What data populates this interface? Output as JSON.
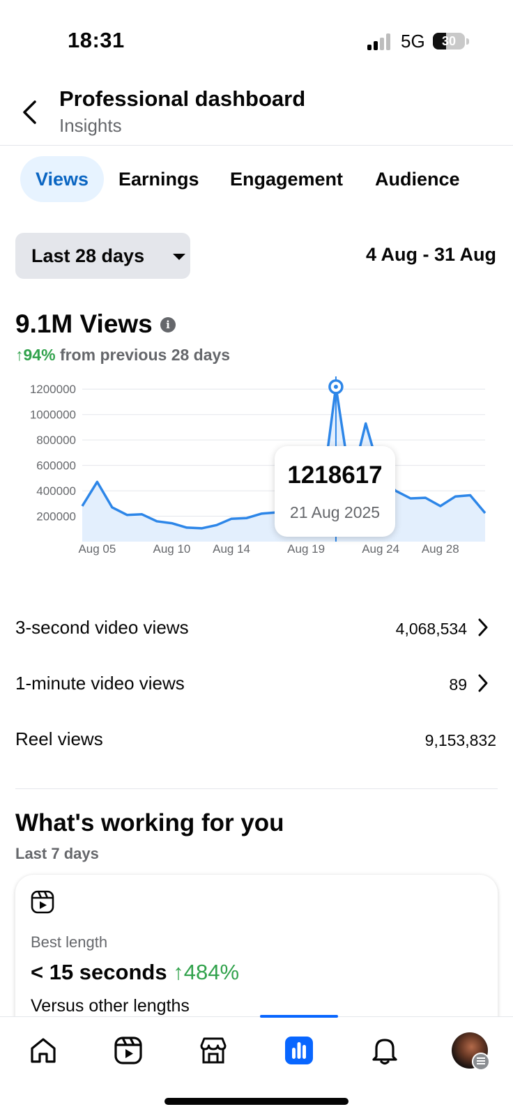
{
  "status_bar": {
    "time": "18:31",
    "network": "5G",
    "battery": "30"
  },
  "header": {
    "title": "Professional dashboard",
    "subtitle": "Insights"
  },
  "tabs": [
    {
      "label": "Views",
      "active": true
    },
    {
      "label": "Earnings",
      "active": false
    },
    {
      "label": "Engagement",
      "active": false
    },
    {
      "label": "Audience",
      "active": false
    }
  ],
  "filter": {
    "period_label": "Last 28 days",
    "date_range": "4 Aug - 31 Aug"
  },
  "summary": {
    "total": "9.1M Views",
    "delta_pct": "↑94%",
    "delta_text": "from previous 28 days"
  },
  "chart_data": {
    "type": "area",
    "x_ticks": [
      "Aug 05",
      "Aug 10",
      "Aug 14",
      "Aug 19",
      "Aug 24",
      "Aug 28"
    ],
    "y_ticks": [
      "1200000",
      "1000000",
      "800000",
      "600000",
      "400000",
      "200000"
    ],
    "ylim": [
      0,
      1300000
    ],
    "x": [
      "4 Aug",
      "5 Aug",
      "6 Aug",
      "7 Aug",
      "8 Aug",
      "9 Aug",
      "10 Aug",
      "11 Aug",
      "12 Aug",
      "13 Aug",
      "14 Aug",
      "15 Aug",
      "16 Aug",
      "17 Aug",
      "18 Aug",
      "19 Aug",
      "20 Aug",
      "21 Aug",
      "22 Aug",
      "23 Aug",
      "24 Aug",
      "25 Aug",
      "26 Aug",
      "27 Aug",
      "28 Aug",
      "29 Aug",
      "30 Aug",
      "31 Aug"
    ],
    "series": [
      {
        "values": [
          280000,
          470000,
          270000,
          210000,
          215000,
          160000,
          145000,
          110000,
          105000,
          130000,
          180000,
          185000,
          220000,
          230000,
          240000,
          270000,
          320000,
          1218617,
          450000,
          930000,
          520000,
          400000,
          340000,
          345000,
          280000,
          355000,
          365000,
          225000
        ]
      }
    ],
    "tooltip": {
      "value": "1218617",
      "date": "21 Aug 2025"
    },
    "grid": true
  },
  "metrics": [
    {
      "label": "3-second video views",
      "value": "4,068,534",
      "has_chevron": true
    },
    {
      "label": "1-minute video views",
      "value": "89",
      "has_chevron": true
    },
    {
      "label": "Reel views",
      "value": "9,153,832",
      "has_chevron": false
    }
  ],
  "whats_working": {
    "title": "What's working for you",
    "subtitle": "Last 7 days",
    "card": {
      "label": "Best length",
      "value": "< 15 seconds",
      "pct": "↑484%",
      "note": "Versus other lengths"
    }
  },
  "bottom_nav": [
    {
      "icon": "home-icon",
      "active": false
    },
    {
      "icon": "reels-icon",
      "active": false
    },
    {
      "icon": "marketplace-icon",
      "active": false
    },
    {
      "icon": "insights-icon",
      "active": true
    },
    {
      "icon": "notifications-icon",
      "active": false
    },
    {
      "icon": "profile-avatar",
      "active": false
    }
  ],
  "colors": {
    "accent": "#0866ff",
    "positive": "#31a24c",
    "chart_line": "#2d86e8",
    "chart_fill": "#e3effd"
  }
}
